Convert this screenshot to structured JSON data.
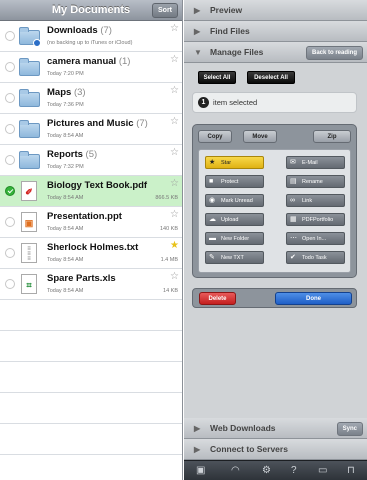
{
  "left": {
    "title": "My Documents",
    "sort_label": "Sort",
    "files": [
      {
        "name": "Downloads",
        "count": "(7)",
        "sub": "(no backing up to iTunes or iCloud)",
        "size": "",
        "type": "folder",
        "badge": true,
        "starred": false,
        "selected": false
      },
      {
        "name": "camera manual",
        "count": "(1)",
        "sub": "Today 7:20 PM",
        "size": "",
        "type": "folder",
        "badge": false,
        "starred": false,
        "selected": false
      },
      {
        "name": "Maps",
        "count": "(3)",
        "sub": "Today 7:36 PM",
        "size": "",
        "type": "folder",
        "badge": false,
        "starred": false,
        "selected": false
      },
      {
        "name": "Pictures and Music",
        "count": "(7)",
        "sub": "Today 8:54 AM",
        "size": "",
        "type": "folder",
        "badge": false,
        "starred": false,
        "selected": false
      },
      {
        "name": "Reports",
        "count": "(5)",
        "sub": "Today 7:32 PM",
        "size": "",
        "type": "folder",
        "badge": false,
        "starred": false,
        "selected": false
      },
      {
        "name": "Biology Text Book.pdf",
        "count": "",
        "sub": "Today 8:54 AM",
        "size": "866.5 KB",
        "type": "pdf",
        "starred": false,
        "selected": true
      },
      {
        "name": "Presentation.ppt",
        "count": "",
        "sub": "Today 8:54 AM",
        "size": "140 KB",
        "type": "ppt",
        "starred": false,
        "selected": false
      },
      {
        "name": "Sherlock Holmes.txt",
        "count": "",
        "sub": "Today 8:54 AM",
        "size": "1.4 MB",
        "type": "txt",
        "starred": true,
        "selected": false
      },
      {
        "name": "Spare Parts.xls",
        "count": "",
        "sub": "Today 8:54 AM",
        "size": "14 KB",
        "type": "xls",
        "starred": false,
        "selected": false
      }
    ]
  },
  "right": {
    "preview": "Preview",
    "find_files": "Find Files",
    "manage_files": "Manage Files",
    "back_to_reading": "Back to reading",
    "select_all": "Select All",
    "deselect_all": "Deselect All",
    "selected_count": "1",
    "selected_text": "item selected",
    "tabs": [
      "Copy",
      "Move",
      "Zip"
    ],
    "actions": [
      {
        "label": "Star",
        "icon": "star-icon"
      },
      {
        "label": "E-Mail",
        "icon": "mail-icon"
      },
      {
        "label": "Protect",
        "icon": "lock-icon"
      },
      {
        "label": "Rename",
        "icon": "rename-icon"
      },
      {
        "label": "Mark Unread",
        "icon": "eye-icon"
      },
      {
        "label": "Link",
        "icon": "link-icon"
      },
      {
        "label": "Upload",
        "icon": "cloud-upload-icon"
      },
      {
        "label": "PDFPortfolio",
        "icon": "portfolio-icon"
      },
      {
        "label": "New Folder",
        "icon": "folder-icon"
      },
      {
        "label": "Open In...",
        "icon": "more-icon"
      },
      {
        "label": "New TXT",
        "icon": "pencil-icon"
      },
      {
        "label": "Todo Task",
        "icon": "check-icon"
      }
    ],
    "delete": "Delete",
    "done": "Done",
    "web_downloads": "Web Downloads",
    "sync": "Sync",
    "connect_servers": "Connect to Servers"
  },
  "colors": {
    "selected_row": "#cbf1c9",
    "delete": "#d92c2c",
    "done": "#2a6fd6",
    "star": "#e8c21a"
  }
}
